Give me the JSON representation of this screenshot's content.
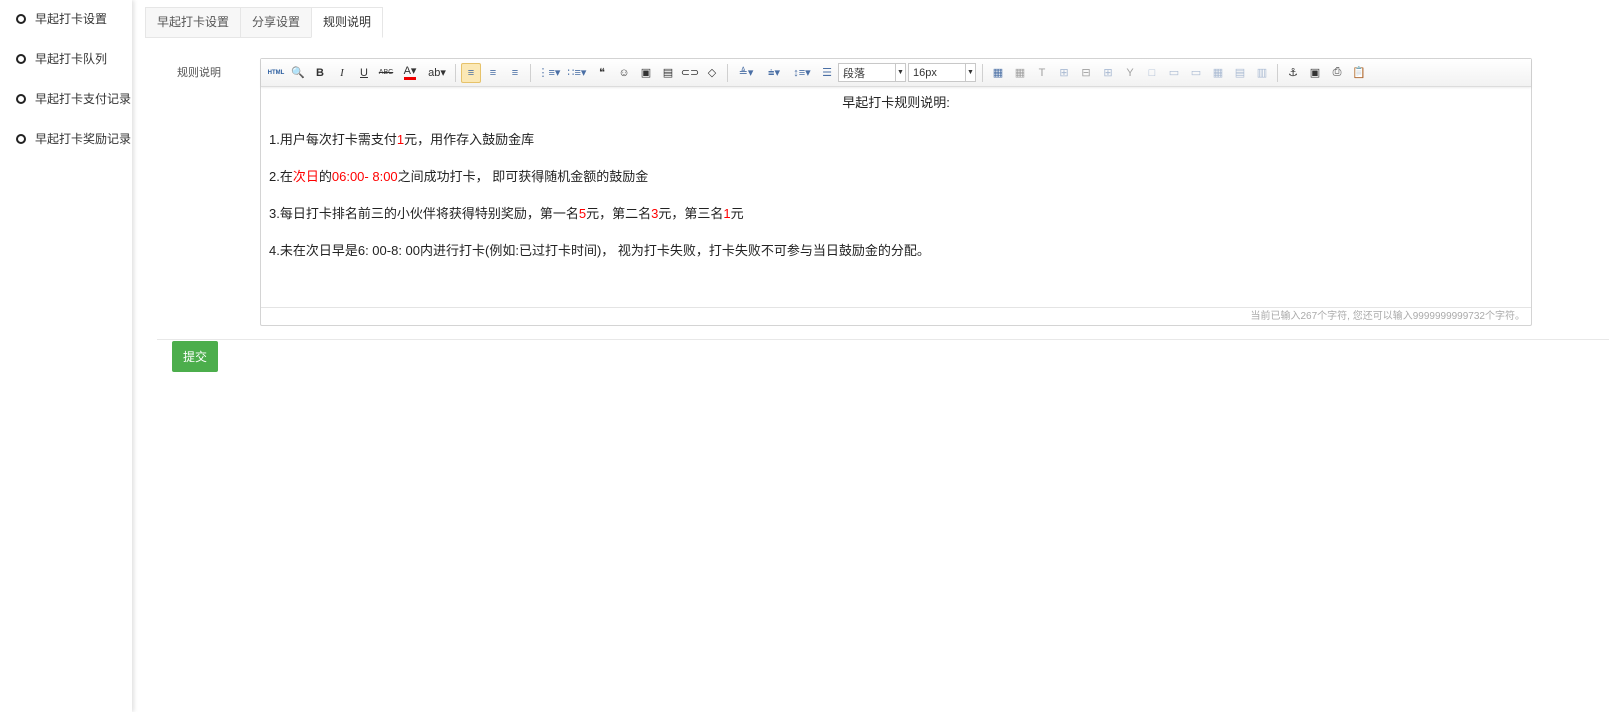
{
  "sidebar": {
    "items": [
      {
        "label": "早起打卡设置"
      },
      {
        "label": "早起打卡队列"
      },
      {
        "label": "早起打卡支付记录"
      },
      {
        "label": "早起打卡奖励记录"
      }
    ]
  },
  "tabs": [
    {
      "label": "早起打卡设置"
    },
    {
      "label": "分享设置"
    },
    {
      "label": "规则说明",
      "active": true
    }
  ],
  "form": {
    "field_label": "规则说明",
    "submit_label": "提交"
  },
  "editor": {
    "toolbar": {
      "html_label": "HTML",
      "paragraph_select": "段落",
      "fontsize_select": "16px",
      "icons": [
        "html-source",
        "preview",
        "bold",
        "italic",
        "underline",
        "strikethrough",
        "font-color",
        "highlight-color",
        "|",
        "justify-left",
        "justify-center",
        "justify-right",
        "|",
        "ordered-list",
        "unordered-list",
        "blockquote",
        "emotion",
        "insert-image",
        "insert-video",
        "link",
        "eraser",
        "|",
        "row-spacing-top",
        "row-spacing-bottom",
        "line-height",
        "paragraph-format"
      ],
      "icons_after": [
        "insert-table",
        "delete-table",
        "insert-caption",
        "insert-row",
        "delete-row",
        "insert-col",
        "delete-col",
        "merge-cells",
        "merge-right",
        "merge-down",
        "split-cells",
        "split-rows",
        "split-cols",
        "|",
        "anchor",
        "template",
        "print",
        "paste"
      ]
    },
    "title": "早起打卡规则说明:",
    "lines": [
      [
        {
          "t": "1.用户每次打卡需支付"
        },
        {
          "t": "1",
          "red": true
        },
        {
          "t": "元，用作存入鼓励金库"
        }
      ],
      [
        {
          "t": "2.在"
        },
        {
          "t": "次日",
          "red": true
        },
        {
          "t": "的"
        },
        {
          "t": "06:00- 8:00",
          "red": true
        },
        {
          "t": "之间成功打卡， 即可获得随机金额的鼓励金"
        }
      ],
      [
        {
          "t": "3.每日打卡排名前三的小伙伴将获得特别奖励，第一名"
        },
        {
          "t": "5",
          "red": true
        },
        {
          "t": "元，第二名"
        },
        {
          "t": "3",
          "red": true
        },
        {
          "t": "元，第三名"
        },
        {
          "t": "1",
          "red": true
        },
        {
          "t": "元"
        }
      ],
      [
        {
          "t": "4.未在次日早是6: 00-8: 00内进行打卡(例如:已过打卡时间)， 视为打卡失败，打卡失败不可参与当日鼓励金的分配。"
        }
      ]
    ],
    "word_count": "当前已输入267个字符, 您还可以输入9999999999732个字符。"
  },
  "colors": {
    "accent_red": "#ff0000",
    "submit_green": "#4cae4c"
  }
}
